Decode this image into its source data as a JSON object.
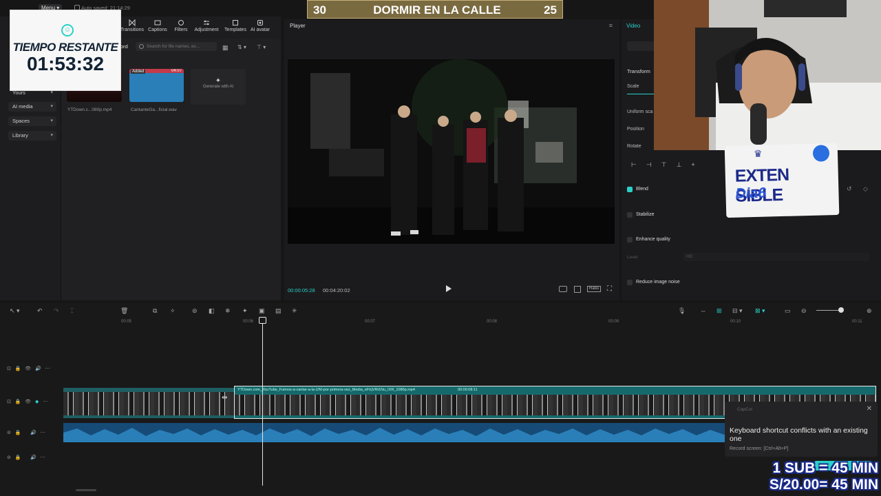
{
  "topbar": {
    "menu_label": "Menu",
    "autosave": "Auto saved: 21:14:29"
  },
  "toolbar": {
    "items": [
      "Transitions",
      "Captions",
      "Filters",
      "Adjustment",
      "Templates",
      "AI avatar"
    ]
  },
  "sidebar": {
    "items": [
      "Yours",
      "AI media",
      "Spaces",
      "Library"
    ]
  },
  "media": {
    "tab_partial": "ord",
    "search_placeholder": "Search for file names, ec...",
    "items": [
      {
        "name": "YTDown.c...080p.mp4"
      },
      {
        "name": "CantanteGa...ficial.wav",
        "badge": "Added",
        "duration": "04:07"
      }
    ],
    "generate_label": "Generate with AI"
  },
  "player": {
    "title": "Player",
    "current_time": "00:00:05:28",
    "total_time": "00:04:20:02",
    "ratio_label": "Ratio"
  },
  "properties": {
    "tab": "Video",
    "section_transform": "Transform",
    "scale": "Scale",
    "uniform_scale": "Uniform sca",
    "position": "Position",
    "rotate": "Rotate",
    "blend": "Blend",
    "stabilize": "Stabilize",
    "enhance_quality": "Enhance quality",
    "level": "Level",
    "level_value": "HD",
    "reduce_noise": "Reduce image noise"
  },
  "timeline": {
    "ruler": [
      "00:05",
      "00:06",
      "00:07",
      "00:08",
      "00:09",
      "00:10",
      "00:11"
    ],
    "clip_label": "YTDown.com_YouTube_Fuimos-a-cantar-a-la-UNI-por-primera-vez_Media_eFtrjVRt1Nu_IXR_1080p.mp4",
    "clip_duration": "00:00:08:11"
  },
  "overlay": {
    "banner_left": "30",
    "banner_title": "DORMIR EN LA CALLE",
    "banner_right": "25",
    "timer_label": "TIEMPO RESTANTE",
    "timer_value": "01:53:32",
    "extensible_word": "EXTEN SIBLE",
    "extensible_day": "Dia6",
    "sub_line1": "1 SUB = 45 MIN",
    "sub_line2": "S/20.00= 45 MIN"
  },
  "toast": {
    "app": "CapCut",
    "message": "Keyboard shortcut conflicts with an existing one",
    "hint": "Record screen: [Ctrl+Alt+P]",
    "action": "Try again"
  },
  "colors": {
    "accent": "#2ad1c9",
    "clip": "#16696b",
    "audio": "#174b77"
  }
}
